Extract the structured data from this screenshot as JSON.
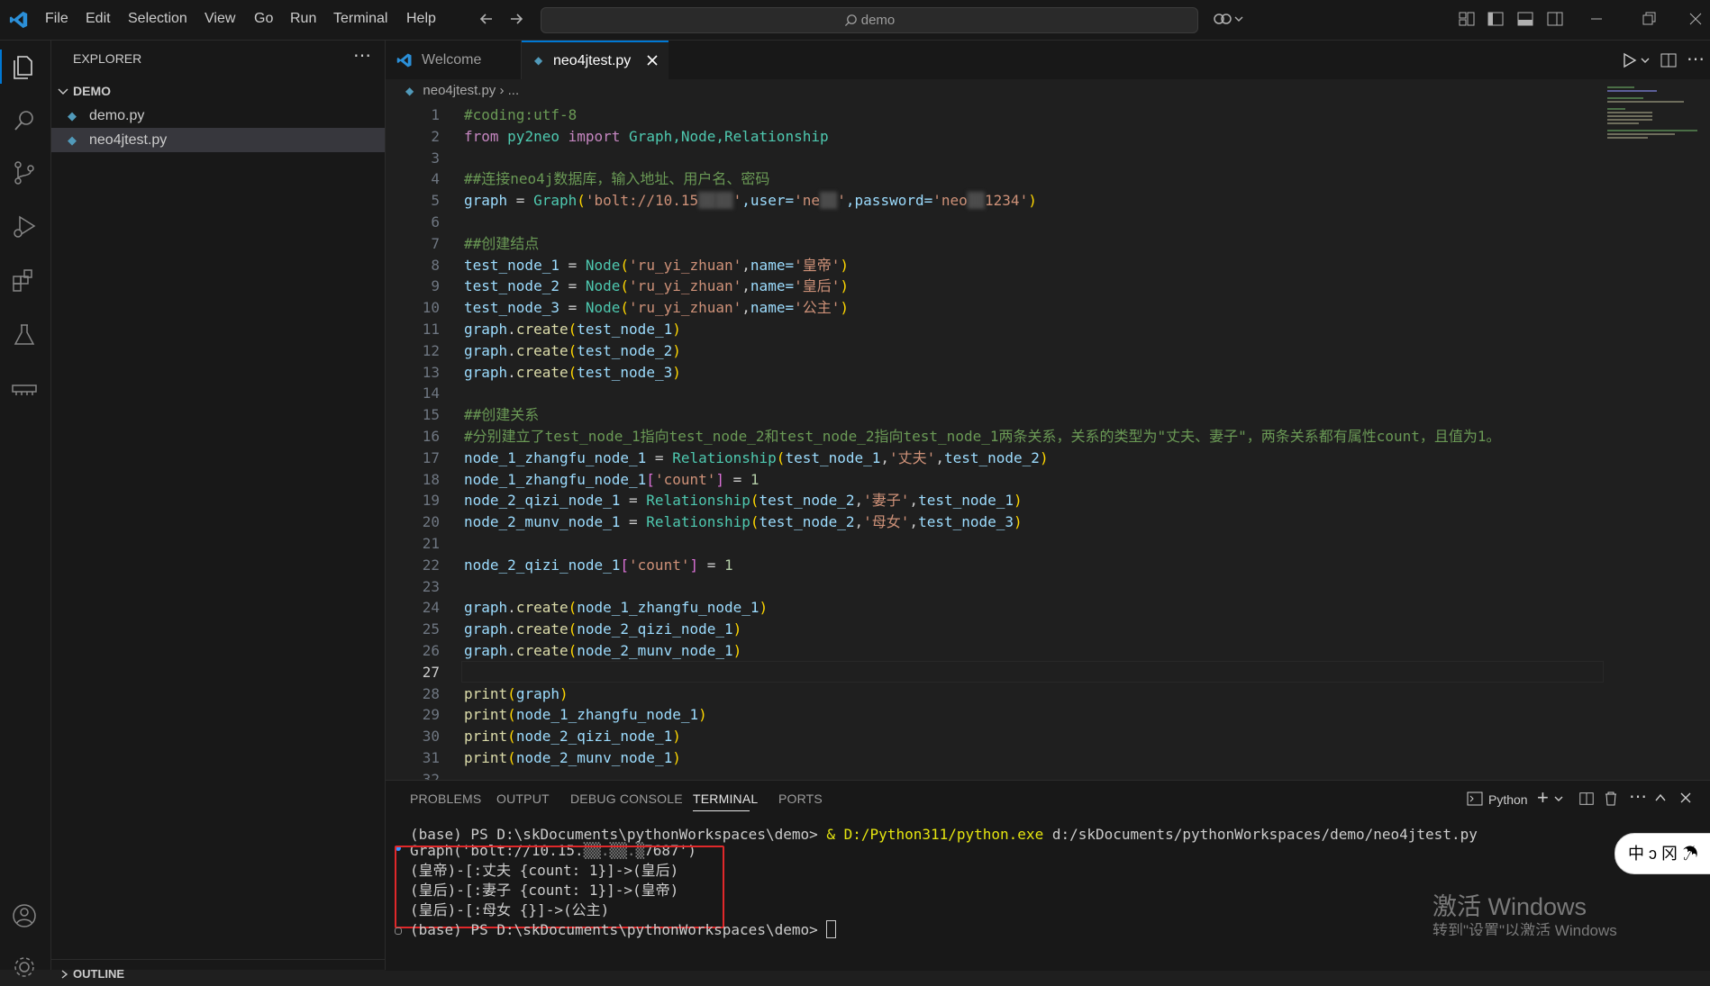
{
  "menu": [
    "File",
    "Edit",
    "Selection",
    "View",
    "Go",
    "Run",
    "Terminal",
    "Help"
  ],
  "search": {
    "text": "demo"
  },
  "explorer": {
    "title": "EXPLORER",
    "folder": "DEMO",
    "files": [
      "demo.py",
      "neo4jtest.py"
    ],
    "outline": "OUTLINE"
  },
  "tabs": [
    {
      "label": "Welcome"
    },
    {
      "label": "neo4jtest.py"
    }
  ],
  "breadcrumb": {
    "file": "neo4jtest.py",
    "more": "..."
  },
  "editor": {
    "lines": [
      {
        "n": "1"
      },
      {
        "n": "2"
      },
      {
        "n": "3"
      },
      {
        "n": "4"
      },
      {
        "n": "5"
      },
      {
        "n": "6"
      },
      {
        "n": "7"
      },
      {
        "n": "8"
      },
      {
        "n": "9"
      },
      {
        "n": "10"
      },
      {
        "n": "11"
      },
      {
        "n": "12"
      },
      {
        "n": "13"
      },
      {
        "n": "14"
      },
      {
        "n": "15"
      },
      {
        "n": "16"
      },
      {
        "n": "17"
      },
      {
        "n": "18"
      },
      {
        "n": "19"
      },
      {
        "n": "20"
      },
      {
        "n": "21"
      },
      {
        "n": "22"
      },
      {
        "n": "23"
      },
      {
        "n": "24"
      },
      {
        "n": "25"
      },
      {
        "n": "26"
      },
      {
        "n": "27"
      },
      {
        "n": "28"
      },
      {
        "n": "29"
      },
      {
        "n": "30"
      },
      {
        "n": "31"
      },
      {
        "n": "32"
      }
    ],
    "code": {
      "l1": "#coding:utf-8",
      "l2_from": "from",
      "l2_mod": "py2neo",
      "l2_import": "import",
      "l2_classes": "Graph,Node,Relationship",
      "l4": "##连接neo4j数据库，输入地址、用户名、密码",
      "l5_a": "graph",
      "l5_b": " = ",
      "l5_c": "Graph",
      "l5_d": "'bolt://10.15",
      "l5_e": "'",
      "l5_f": ",user=",
      "l5_g": "'ne",
      "l5_h": "'",
      "l5_i": ",password=",
      "l5_j": "'neo",
      "l5_k": "1234'",
      "l7": "##创建结点",
      "l8_var": "test_node_1",
      "l8_str1": "'ru_yi_zhuan'",
      "l8_kw": "name=",
      "l8_str2": "'皇帝'",
      "l9_var": "test_node_2",
      "l9_str2": "'皇后'",
      "l10_var": "test_node_3",
      "l10_str2": "'公主'",
      "l11_arg": "test_node_1",
      "l12_arg": "test_node_2",
      "l13_arg": "test_node_3",
      "l15": "##创建关系",
      "l16": "#分别建立了test_node_1指向test_node_2和test_node_2指向test_node_1两条关系，关系的类型为\"丈夫、妻子\"，两条关系都有属性count，且值为1。",
      "l17_var": "node_1_zhangfu_node_1",
      "l17_a": "test_node_1",
      "l17_s": "'丈夫'",
      "l17_b": "test_node_2",
      "l18_var": "node_1_zhangfu_node_1",
      "l18_s": "'count'",
      "l18_n": "1",
      "l19_var": "node_2_qizi_node_1",
      "l19_a": "test_node_2",
      "l19_s": "'妻子'",
      "l19_b": "test_node_1",
      "l20_var": "node_2_munv_node_1",
      "l20_a": "test_node_2",
      "l20_s": "'母女'",
      "l20_b": "test_node_3",
      "l22_var": "node_2_qizi_node_1",
      "l22_s": "'count'",
      "l22_n": "1",
      "l24_arg": "node_1_zhangfu_node_1",
      "l25_arg": "node_2_qizi_node_1",
      "l26_arg": "node_2_munv_node_1",
      "l28_arg": "graph",
      "l29_arg": "node_1_zhangfu_node_1",
      "l30_arg": "node_2_qizi_node_1",
      "l31_arg": "node_2_munv_node_1",
      "graph_obj": "graph",
      "create": "create",
      "print": "print",
      "Node": "Node",
      "Relationship": "Relationship"
    }
  },
  "panel": {
    "tabs": [
      "PROBLEMS",
      "OUTPUT",
      "DEBUG CONSOLE",
      "TERMINAL",
      "PORTS"
    ],
    "shell": "Python",
    "terminal": {
      "cmd_prompt": "(base) PS D:\\skDocuments\\pythonWorkspaces\\demo> ",
      "cmd_amp": "& ",
      "cmd_exe": "D:/Python311/python.exe",
      "cmd_arg": " d:/skDocuments/pythonWorkspaces/demo/neo4jtest.py",
      "out1": "Graph('bolt://10.15.",
      "out1_end": "7687')",
      "out2": "(皇帝)-[:丈夫 {count: 1}]->(皇后)",
      "out3": "(皇后)-[:妻子 {count: 1}]->(皇帝)",
      "out4": "(皇后)-[:母女 {}]->(公主)",
      "prompt2": "(base) PS D:\\skDocuments\\pythonWorkspaces\\demo> "
    }
  },
  "watermark": {
    "line1": "激活 Windows",
    "line2": "转到\"设置\"以激活 Windows"
  },
  "colors": {
    "accent": "#0078d4",
    "highlight_box": "#e0282a"
  }
}
